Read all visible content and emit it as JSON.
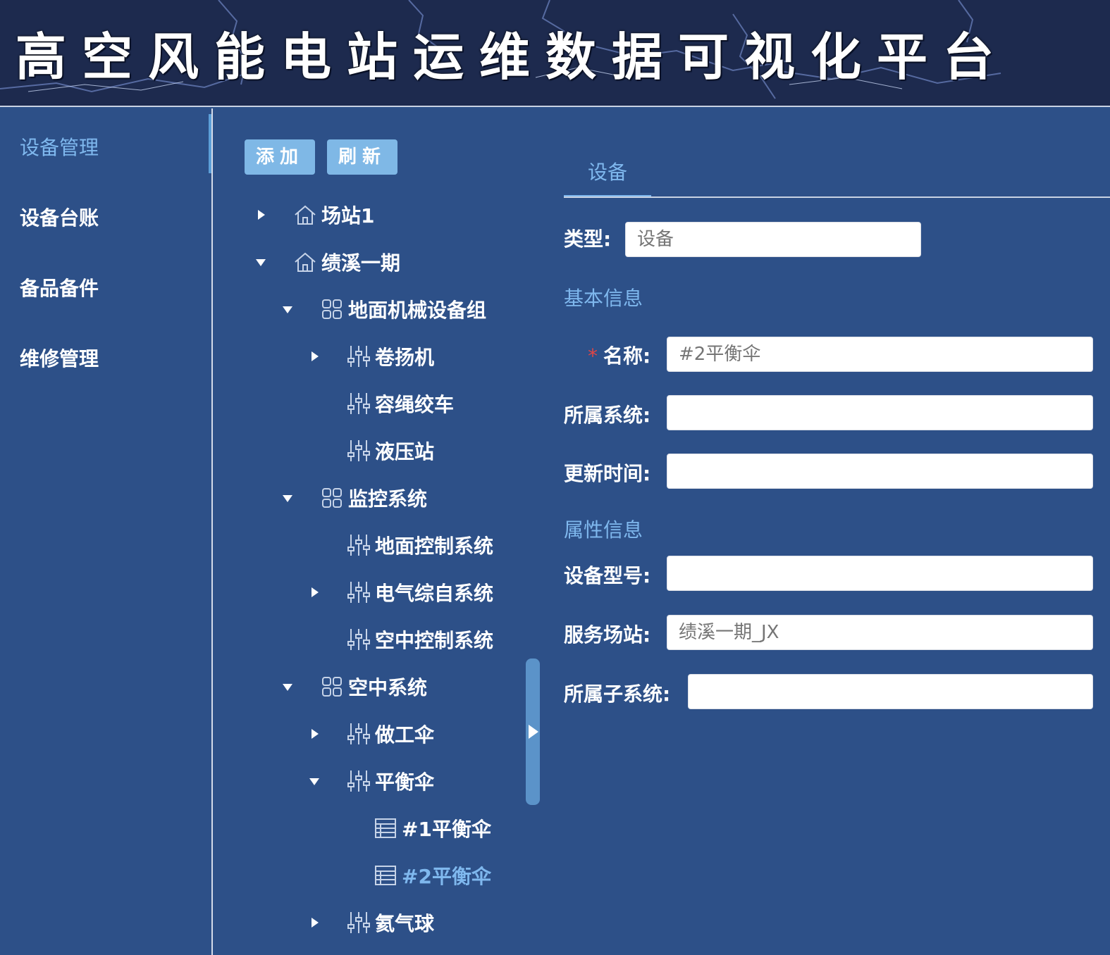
{
  "header": {
    "title": "高空风能电站运维数据可视化平台"
  },
  "sidebar": {
    "items": [
      {
        "label": "设备管理",
        "active": true
      },
      {
        "label": "设备台账",
        "active": false
      },
      {
        "label": "备品备件",
        "active": false
      },
      {
        "label": "维修管理",
        "active": false
      }
    ]
  },
  "toolbar": {
    "add_label": "添加",
    "refresh_label": "刷新"
  },
  "tree": {
    "nodes": [
      {
        "label": "场站1",
        "icon": "station-icon",
        "caret": "collapsed"
      },
      {
        "label": "绩溪一期",
        "icon": "station-icon",
        "caret": "expanded"
      },
      {
        "label": "地面机械设备组",
        "icon": "group-icon",
        "caret": "expanded"
      },
      {
        "label": "卷扬机",
        "icon": "equipment-icon",
        "caret": "collapsed"
      },
      {
        "label": "容绳绞车",
        "icon": "equipment-icon",
        "caret": "none"
      },
      {
        "label": "液压站",
        "icon": "equipment-icon",
        "caret": "none"
      },
      {
        "label": "监控系统",
        "icon": "group-icon",
        "caret": "expanded"
      },
      {
        "label": "地面控制系统",
        "icon": "equipment-icon",
        "caret": "none"
      },
      {
        "label": "电气综自系统",
        "icon": "equipment-icon",
        "caret": "collapsed"
      },
      {
        "label": "空中控制系统",
        "icon": "equipment-icon",
        "caret": "none"
      },
      {
        "label": "空中系统",
        "icon": "group-icon",
        "caret": "expanded"
      },
      {
        "label": "做工伞",
        "icon": "equipment-icon",
        "caret": "collapsed"
      },
      {
        "label": "平衡伞",
        "icon": "equipment-icon",
        "caret": "expanded"
      },
      {
        "label": "#1平衡伞",
        "icon": "device-icon",
        "caret": "none"
      },
      {
        "label": "#2平衡伞",
        "icon": "device-icon",
        "caret": "none",
        "selected": true
      },
      {
        "label": "氦气球",
        "icon": "equipment-icon",
        "caret": "collapsed"
      }
    ]
  },
  "detail": {
    "tab_label": "设备",
    "type_label": "类型:",
    "type_placeholder": "设备",
    "basic_section": "基本信息",
    "name_required_mark": "*",
    "name_label": "名称:",
    "name_placeholder": "#2平衡伞",
    "system_label": "所属系统:",
    "system_placeholder": "",
    "updated_label": "更新时间:",
    "updated_placeholder": "",
    "attr_section": "属性信息",
    "model_label": "设备型号:",
    "model_placeholder": "",
    "station_label": "服务场站:",
    "station_placeholder": "绩溪一期_JX",
    "subsystem_label": "所属子系统:",
    "subsystem_placeholder": ""
  },
  "colors": {
    "background": "#2d5088",
    "header_bg": "#1d2a4e",
    "accent": "#7fb8ee",
    "button": "#7fb8e6",
    "required": "#e04646"
  }
}
